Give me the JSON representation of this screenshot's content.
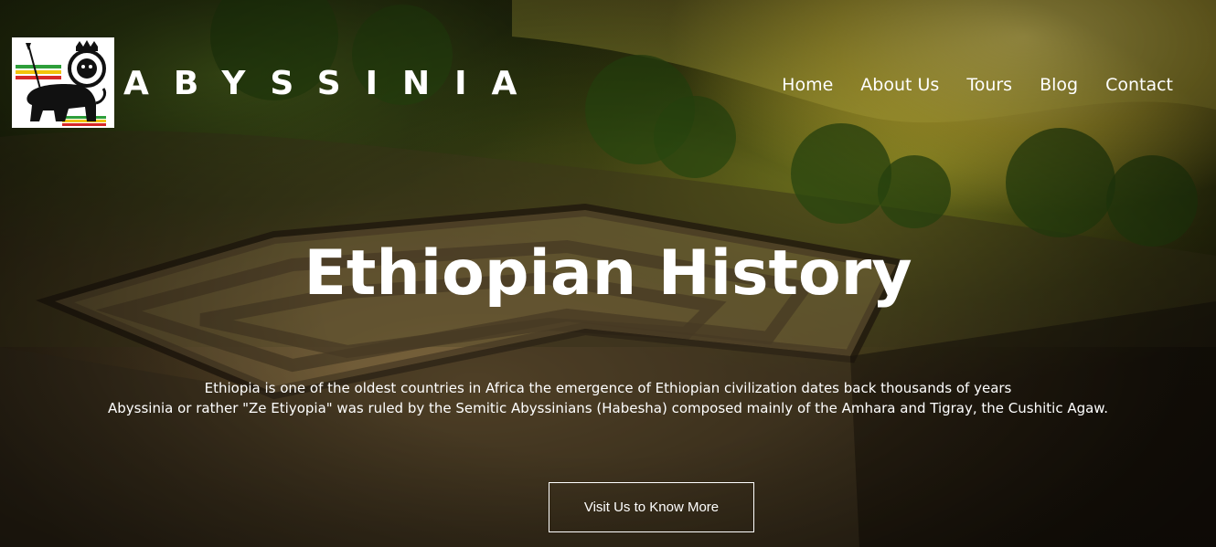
{
  "brand": {
    "name": "ABYSSINIA",
    "logo_icon": "lion-of-judah-icon"
  },
  "nav": {
    "items": [
      {
        "label": "Home"
      },
      {
        "label": "About Us"
      },
      {
        "label": "Tours"
      },
      {
        "label": "Blog"
      },
      {
        "label": "Contact"
      }
    ]
  },
  "hero": {
    "title": "Ethiopian History",
    "lines": [
      "Ethiopia is one of the oldest countries in Africa the emergence of Ethiopian civilization dates back thousands of years",
      "Abyssinia or rather \"Ze Etiyopia\" was ruled by the Semitic Abyssinians (Habesha) composed mainly of the Amhara and Tigray, the Cushitic Agaw."
    ],
    "cta_label": "Visit Us to Know More"
  },
  "colors": {
    "text": "#ffffff",
    "logo_green": "#2e9e3a",
    "logo_yellow": "#f2c40c",
    "logo_red": "#d62828"
  }
}
